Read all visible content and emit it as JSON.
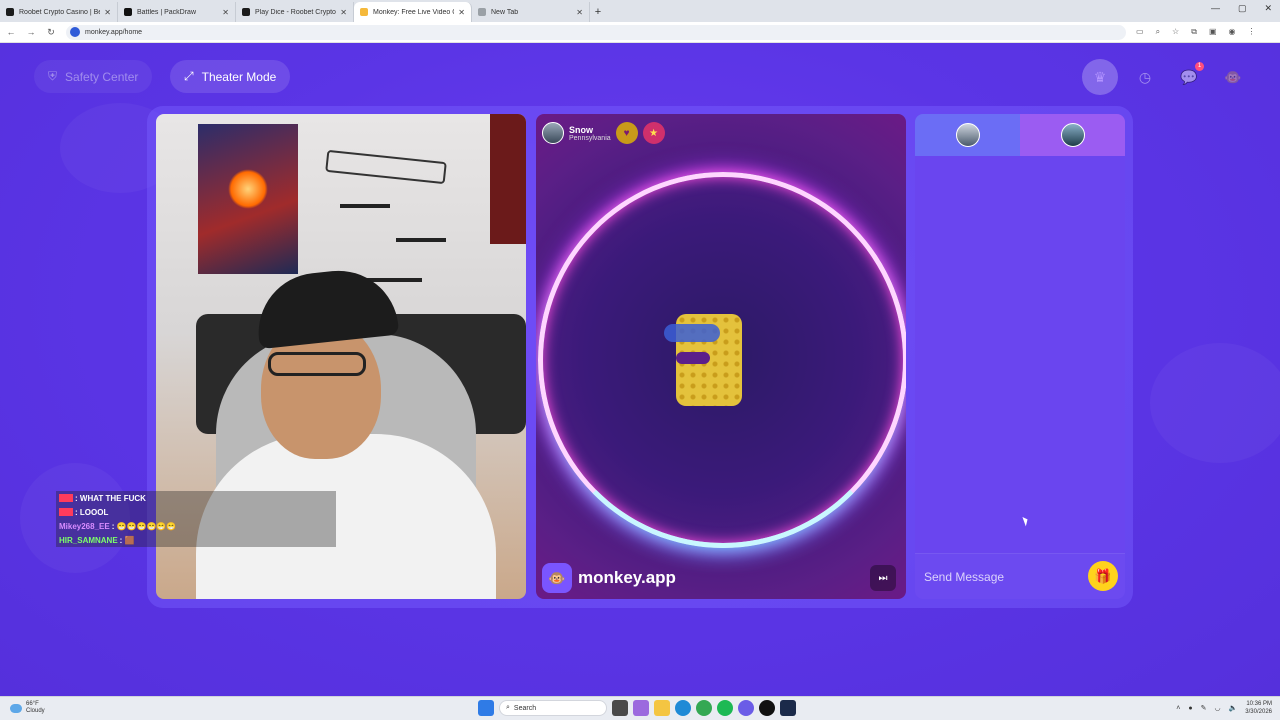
{
  "browser": {
    "tabs": [
      {
        "title": "Roobet Crypto Casino | Best Bi",
        "color": "#1c1c1c",
        "active": false
      },
      {
        "title": "Battles | PackDraw",
        "color": "#111111",
        "active": false
      },
      {
        "title": "Play Dice - Roobet Crypto Casi",
        "color": "#1c1c1c",
        "active": false
      },
      {
        "title": "Monkey: Free Live Video Ch",
        "color": "#f5b93b",
        "active": true
      },
      {
        "title": "New Tab",
        "color": "#9aa0a6",
        "active": false
      }
    ],
    "url": "monkey.app/home"
  },
  "top": {
    "safety_label": "Safety Center",
    "theater_label": "Theater Mode",
    "notif_count": "1"
  },
  "left_video": {
    "chat": [
      {
        "user": "",
        "user_color": "#ff3b5c",
        "msg": ": WHAT THE FUCK"
      },
      {
        "user": "",
        "user_color": "#ff3b5c",
        "msg": ": LOOOL"
      },
      {
        "user": "Mikey268_EE",
        "user_color": "#d88cff",
        "msg": ": 😁😁😁😁😁😁"
      },
      {
        "user": "HIR_SAMNANE",
        "user_color": "#7dff6a",
        "msg": ": 🟫"
      }
    ]
  },
  "partner": {
    "name": "Snow",
    "location": "Pennsylvania",
    "watermark": "monkey.app"
  },
  "chat_panel": {
    "placeholder": "Send Message"
  },
  "taskbar": {
    "temp": "66°F",
    "condition": "Cloudy",
    "search": "Search",
    "time": "10:36 PM",
    "date": "3/30/2026"
  }
}
